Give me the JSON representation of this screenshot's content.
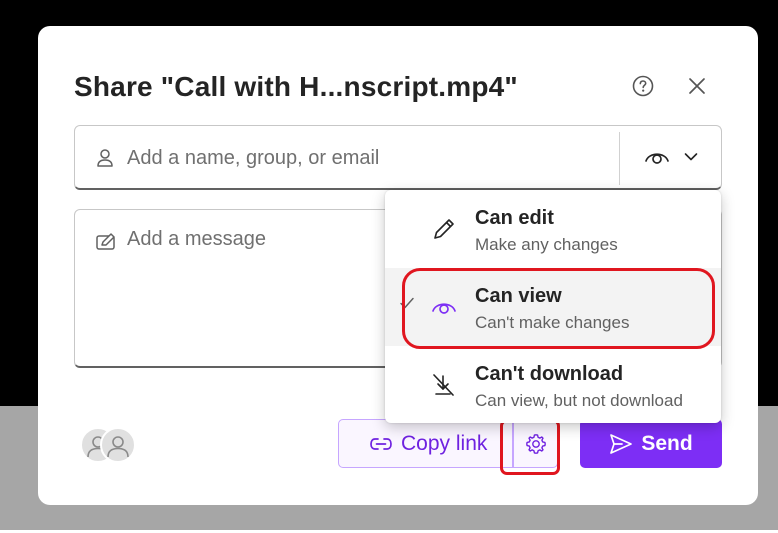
{
  "dialog": {
    "title": "Share \"Call with H...nscript.mp4\"",
    "help_icon": "question-circle-icon",
    "close_icon": "close-icon"
  },
  "recipients": {
    "placeholder": "Add a name, group, or email",
    "icon": "person-icon",
    "permission_icon": "eye-icon",
    "dropdown_icon": "chevron-down-icon"
  },
  "message": {
    "placeholder": "Add a message",
    "icon": "edit-message-icon"
  },
  "permissions_menu": {
    "items": [
      {
        "title": "Can edit",
        "description": "Make any changes",
        "icon": "pencil-icon",
        "selected": false
      },
      {
        "title": "Can view",
        "description": "Can't make changes",
        "icon": "eye-icon",
        "selected": true
      },
      {
        "title": "Can't download",
        "description": "Can view, but not download",
        "icon": "no-download-icon",
        "selected": false
      }
    ]
  },
  "footer": {
    "copy_link_label": "Copy link",
    "copy_link_icon": "link-icon",
    "settings_icon": "gear-icon",
    "send_label": "Send",
    "send_icon": "send-icon",
    "avatars_icon": "people-icon"
  },
  "colors": {
    "accent": "#7d2ef5",
    "accent_text": "#6f22e0",
    "annotation": "#e0161f"
  }
}
